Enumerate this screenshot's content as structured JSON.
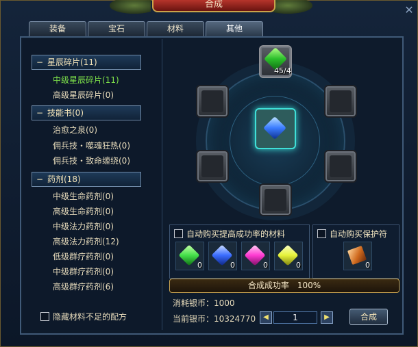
{
  "window": {
    "title": "合成"
  },
  "tabs": [
    {
      "label": "装备"
    },
    {
      "label": "宝石"
    },
    {
      "label": "材料"
    },
    {
      "label": "其他"
    }
  ],
  "categories": [
    {
      "label": "星辰碎片(11)",
      "items": [
        {
          "label": "中级星辰碎片(11)"
        },
        {
          "label": "高级星辰碎片(0)"
        }
      ]
    },
    {
      "label": "技能书(0)",
      "items": [
        {
          "label": "治愈之泉(0)"
        },
        {
          "label": "佣兵技・噬魂狂热(0)"
        },
        {
          "label": "佣兵技・致命缠绕(0)"
        }
      ]
    },
    {
      "label": "药剂(18)",
      "items": [
        {
          "label": "中级生命药剂(0)"
        },
        {
          "label": "高级生命药剂(0)"
        },
        {
          "label": "中级法力药剂(0)"
        },
        {
          "label": "高级法力药剂(12)"
        },
        {
          "label": "低级群疗药剂(0)"
        },
        {
          "label": "中级群疗药剂(0)"
        },
        {
          "label": "高级群疗药剂(6)"
        }
      ]
    }
  ],
  "hide_missing_label": "隐藏材料不足的配方",
  "top_slot_count": "45/4",
  "auto_buy_materials": {
    "label": "自动购买提高成功率的材料",
    "items": [
      {
        "color": "#44e04a",
        "count": "0"
      },
      {
        "color": "#3a6cff",
        "count": "0"
      },
      {
        "color": "#ff3ad2",
        "count": "0"
      },
      {
        "color": "#e6f23a",
        "count": "0"
      }
    ]
  },
  "auto_buy_charm": {
    "label": "自动购买保护符",
    "count": "0"
  },
  "success_rate_label": "合成成功率　100%",
  "cost_silver": "消耗银币：1000",
  "current_silver": "当前银币：10324770",
  "quantity": "1",
  "synth_button": "合成"
}
